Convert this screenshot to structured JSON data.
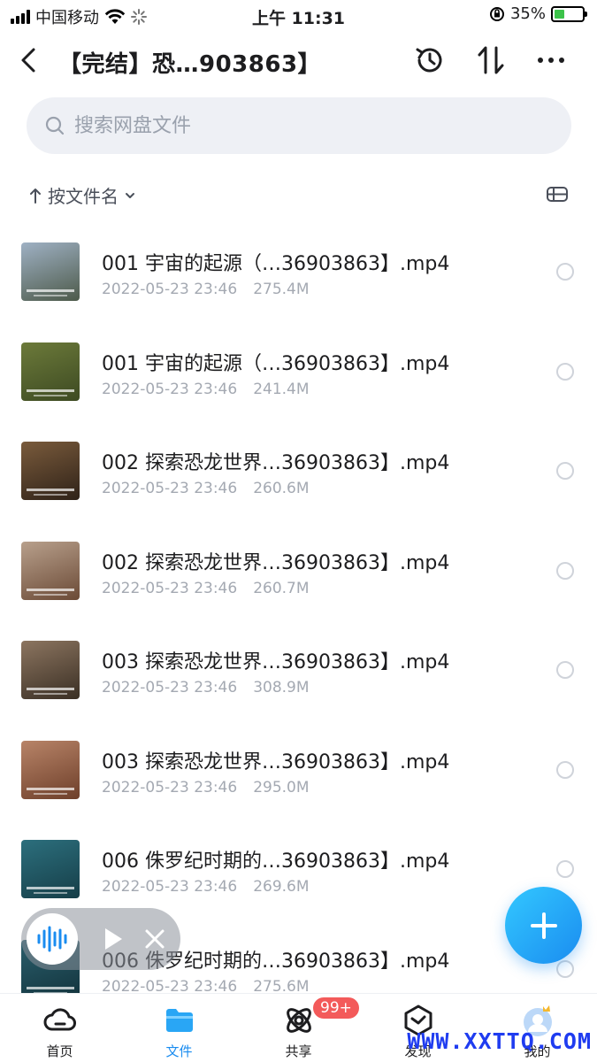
{
  "status_bar": {
    "carrier": "中国移动",
    "time": "上午 11:31",
    "battery": "35%",
    "battery_level": 0.35
  },
  "header": {
    "title": "【完结】恐…903863】",
    "back_icon": "chevron-left-icon",
    "icons": [
      "history-icon",
      "sort-arrows-icon",
      "more-icon"
    ]
  },
  "search": {
    "placeholder": "搜索网盘文件"
  },
  "sort": {
    "label": "按文件名"
  },
  "files": [
    {
      "name": "001 宇宙的起源（…36903863】.mp4",
      "date": "2022-05-23 23:46",
      "size": "275.4M",
      "thumb": [
        "#9fb1c4",
        "#4d5a4a"
      ]
    },
    {
      "name": "001 宇宙的起源（…36903863】.mp4",
      "date": "2022-05-23 23:46",
      "size": "241.4M",
      "thumb": [
        "#6c7a3a",
        "#3d4a22"
      ]
    },
    {
      "name": "002 探索恐龙世界…36903863】.mp4",
      "date": "2022-05-23 23:46",
      "size": "260.6M",
      "thumb": [
        "#7a5b3c",
        "#2f2218"
      ]
    },
    {
      "name": "002 探索恐龙世界…36903863】.mp4",
      "date": "2022-05-23 23:46",
      "size": "260.7M",
      "thumb": [
        "#b8a08c",
        "#6b4a36"
      ]
    },
    {
      "name": "003 探索恐龙世界…36903863】.mp4",
      "date": "2022-05-23 23:46",
      "size": "308.9M",
      "thumb": [
        "#8c7560",
        "#3a2f24"
      ]
    },
    {
      "name": "003 探索恐龙世界…36903863】.mp4",
      "date": "2022-05-23 23:46",
      "size": "295.0M",
      "thumb": [
        "#b88468",
        "#6e3f2a"
      ]
    },
    {
      "name": "006 侏罗纪时期的…36903863】.mp4",
      "date": "2022-05-23 23:46",
      "size": "269.6M",
      "thumb": [
        "#2c6f7d",
        "#163e48"
      ]
    },
    {
      "name": "006 侏罗纪时期的…36903863】.mp4",
      "date": "2022-05-23 23:46",
      "size": "275.6M",
      "thumb": [
        "#2a5e6c",
        "#13343d"
      ]
    }
  ],
  "tabs": [
    {
      "label": "首页",
      "icon": "cloud-icon",
      "active": false
    },
    {
      "label": "文件",
      "icon": "folder-icon",
      "active": true
    },
    {
      "label": "共享",
      "icon": "orbit-icon",
      "active": false,
      "badge": "99+"
    },
    {
      "label": "发现",
      "icon": "discover-icon",
      "active": false
    },
    {
      "label": "我的",
      "icon": "avatar-icon",
      "active": false
    }
  ],
  "watermark": "WWW.XXTTQ.COM",
  "colors": {
    "accent": "#1a8cf0",
    "badge": "#f35a5a",
    "meta_text": "#a4a9b2"
  }
}
